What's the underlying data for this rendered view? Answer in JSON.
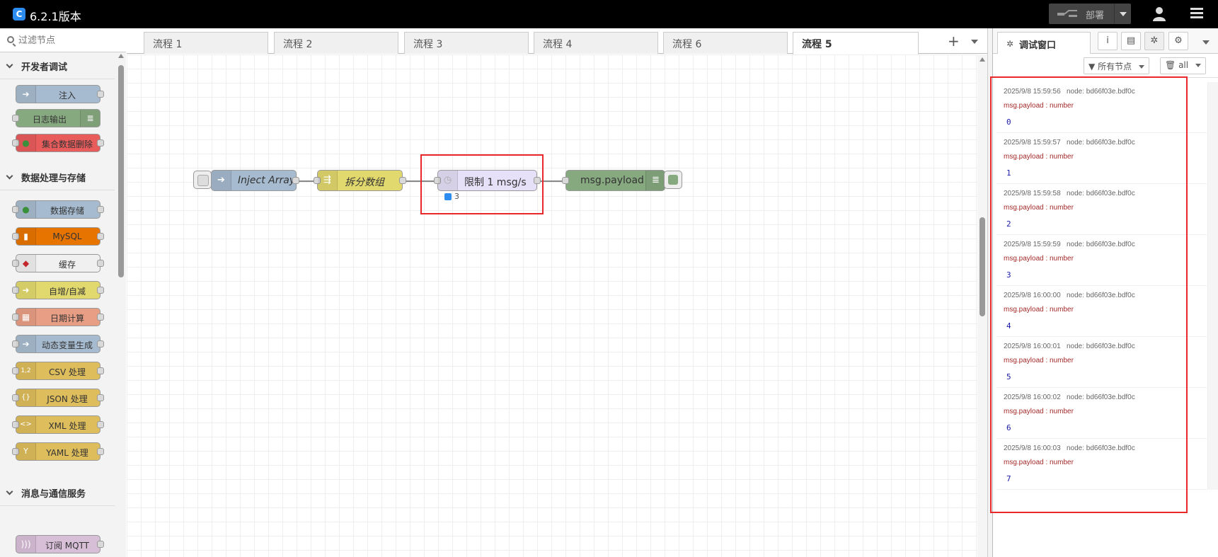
{
  "header": {
    "logo_text": "C",
    "title": "6.2.1版本",
    "deploy_label": "部署"
  },
  "palette": {
    "filter_placeholder": "过滤节点",
    "categories": [
      {
        "label": "开发者调试",
        "nodes": [
          {
            "label": "注入",
            "color": "#a6bbcf",
            "icon": "arrow-right-icon"
          },
          {
            "label": "日志输出",
            "color": "#87a980",
            "icon": "list-icon"
          },
          {
            "label": "集合数据删除",
            "color": "#e85c5c",
            "icon": "leaf-icon"
          }
        ]
      },
      {
        "label": "数据处理与存储",
        "nodes": [
          {
            "label": "数据存储",
            "color": "#a6bbcf",
            "icon": "leaf-icon"
          },
          {
            "label": "MySQL",
            "color": "#e87400",
            "icon": "database-icon"
          },
          {
            "label": "缓存",
            "color": "#f0f0f0",
            "icon": "redis-icon"
          },
          {
            "label": "自增/自减",
            "color": "#e2d96e",
            "icon": "arrow-icon"
          },
          {
            "label": "日期计算",
            "color": "#e89e84",
            "icon": "calendar-icon"
          },
          {
            "label": "动态变量生成",
            "color": "#a6bbcf",
            "icon": "arrow-right-icon"
          },
          {
            "label": "CSV 处理",
            "color": "#debd5c",
            "icon": "csv-icon"
          },
          {
            "label": "JSON 处理",
            "color": "#debd5c",
            "icon": "json-icon"
          },
          {
            "label": "XML 处理",
            "color": "#debd5c",
            "icon": "xml-icon"
          },
          {
            "label": "YAML 处理",
            "color": "#debd5c",
            "icon": "yaml-icon"
          }
        ]
      },
      {
        "label": "消息与通信服务",
        "nodes": [
          {
            "label": "订阅 MQTT",
            "color": "#d8bfd8",
            "icon": "wave-icon"
          }
        ]
      }
    ]
  },
  "tabs": [
    "流程 1",
    "流程 2",
    "流程 3",
    "流程 4",
    "流程 6",
    "流程 5"
  ],
  "active_tab": "流程 5",
  "flow": {
    "nodes": [
      {
        "label": "Inject Array",
        "color": "#a6bbcf"
      },
      {
        "label": "拆分数组",
        "color": "#e2d96e"
      },
      {
        "label": "限制 1 msg/s",
        "color": "#e6e0f8"
      },
      {
        "label": "msg.payload",
        "color": "#87a980"
      }
    ],
    "status_text": "3"
  },
  "sidebar": {
    "tab_label": "调试窗口",
    "filter_label": "所有节点",
    "clear_label": "all",
    "messages": [
      {
        "time": "2025/9/8 15:59:56",
        "node": "node: bd66f03e.bdf0c",
        "topic": "msg.payload : number",
        "value": "0"
      },
      {
        "time": "2025/9/8 15:59:57",
        "node": "node: bd66f03e.bdf0c",
        "topic": "msg.payload : number",
        "value": "1"
      },
      {
        "time": "2025/9/8 15:59:58",
        "node": "node: bd66f03e.bdf0c",
        "topic": "msg.payload : number",
        "value": "2"
      },
      {
        "time": "2025/9/8 15:59:59",
        "node": "node: bd66f03e.bdf0c",
        "topic": "msg.payload : number",
        "value": "3"
      },
      {
        "time": "2025/9/8 16:00:00",
        "node": "node: bd66f03e.bdf0c",
        "topic": "msg.payload : number",
        "value": "4"
      },
      {
        "time": "2025/9/8 16:00:01",
        "node": "node: bd66f03e.bdf0c",
        "topic": "msg.payload : number",
        "value": "5"
      },
      {
        "time": "2025/9/8 16:00:02",
        "node": "node: bd66f03e.bdf0c",
        "topic": "msg.payload : number",
        "value": "6"
      },
      {
        "time": "2025/9/8 16:00:03",
        "node": "node: bd66f03e.bdf0c",
        "topic": "msg.payload : number",
        "value": "7"
      }
    ]
  },
  "colors": {
    "highlight": "#e8282b",
    "header_bg": "#000000"
  }
}
